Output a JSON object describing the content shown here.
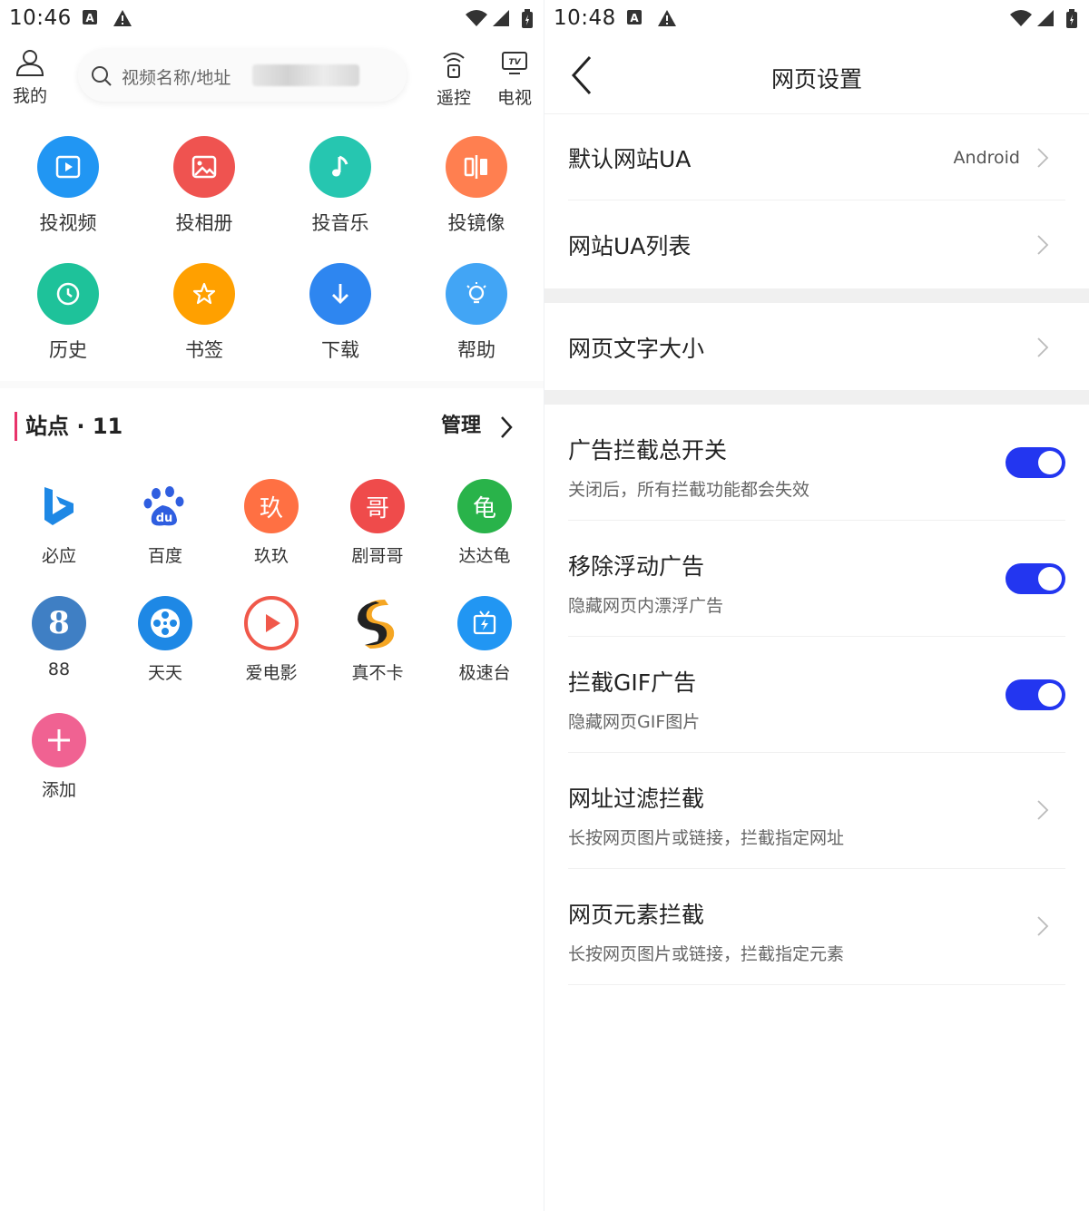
{
  "left_screen": {
    "status_bar": {
      "time": "10:46"
    },
    "top_bar": {
      "mine_label": "我的",
      "search_placeholder": "视频名称/地址",
      "remote_label": "遥控",
      "tv_label": "电视"
    },
    "functions": [
      {
        "label": "投视频",
        "icon": "video-play-icon",
        "color": "#2196f3"
      },
      {
        "label": "投相册",
        "icon": "image-icon",
        "color": "#ef5350"
      },
      {
        "label": "投音乐",
        "icon": "music-note-icon",
        "color": "#26c6b0"
      },
      {
        "label": "投镜像",
        "icon": "mirror-icon",
        "color": "#ff7f50"
      },
      {
        "label": "历史",
        "icon": "clock-icon",
        "color": "#1ec29a"
      },
      {
        "label": "书签",
        "icon": "star-icon",
        "color": "#ffa000"
      },
      {
        "label": "下载",
        "icon": "download-arrow-icon",
        "color": "#2e86f0"
      },
      {
        "label": "帮助",
        "icon": "lightbulb-icon",
        "color": "#42a5f5"
      }
    ],
    "sites": {
      "title": "站点 · 11",
      "manage_label": "管理",
      "items": [
        {
          "label": "必应",
          "icon": "bing-logo-icon",
          "color": "#1e88e5"
        },
        {
          "label": "百度",
          "icon": "baidu-paw-icon",
          "color": "#2f5ee0"
        },
        {
          "label": "玖玖",
          "glyph": "玖",
          "color": "#ff7043"
        },
        {
          "label": "剧哥哥",
          "glyph": "哥",
          "color": "#ef4b4b"
        },
        {
          "label": "达达龟",
          "glyph": "龟",
          "color": "#29b34a"
        },
        {
          "label": "88",
          "glyph": "8",
          "color": "#3f7fc4"
        },
        {
          "label": "天天",
          "icon": "film-reel-icon",
          "color": "#1e88e5"
        },
        {
          "label": "爱电影",
          "icon": "play-circle-icon",
          "color": "#f0584a"
        },
        {
          "label": "真不卡",
          "icon": "s-logo-icon",
          "color": "#f5a623"
        },
        {
          "label": "极速台",
          "icon": "tv-bolt-icon",
          "color": "#2196f3"
        },
        {
          "label": "添加",
          "icon": "plus-icon",
          "color": "#f06292"
        }
      ]
    }
  },
  "right_screen": {
    "status_bar": {
      "time": "10:48"
    },
    "header": {
      "title": "网页设置"
    },
    "ua_default": {
      "title": "默认网站UA",
      "value": "Android"
    },
    "ua_list": {
      "title": "网站UA列表"
    },
    "font_size": {
      "title": "网页文字大小"
    },
    "ad_master": {
      "title": "广告拦截总开关",
      "subtitle": "关闭后，所有拦截功能都会失效",
      "enabled": true
    },
    "float_ad": {
      "title": "移除浮动广告",
      "subtitle": "隐藏网页内漂浮广告",
      "enabled": true
    },
    "gif_ad": {
      "title": "拦截GIF广告",
      "subtitle": "隐藏网页GIF图片",
      "enabled": true
    },
    "url_filter": {
      "title": "网址过滤拦截",
      "subtitle": "长按网页图片或链接，拦截指定网址"
    },
    "element_block": {
      "title": "网页元素拦截",
      "subtitle": "长按网页图片或链接，拦截指定元素"
    }
  }
}
